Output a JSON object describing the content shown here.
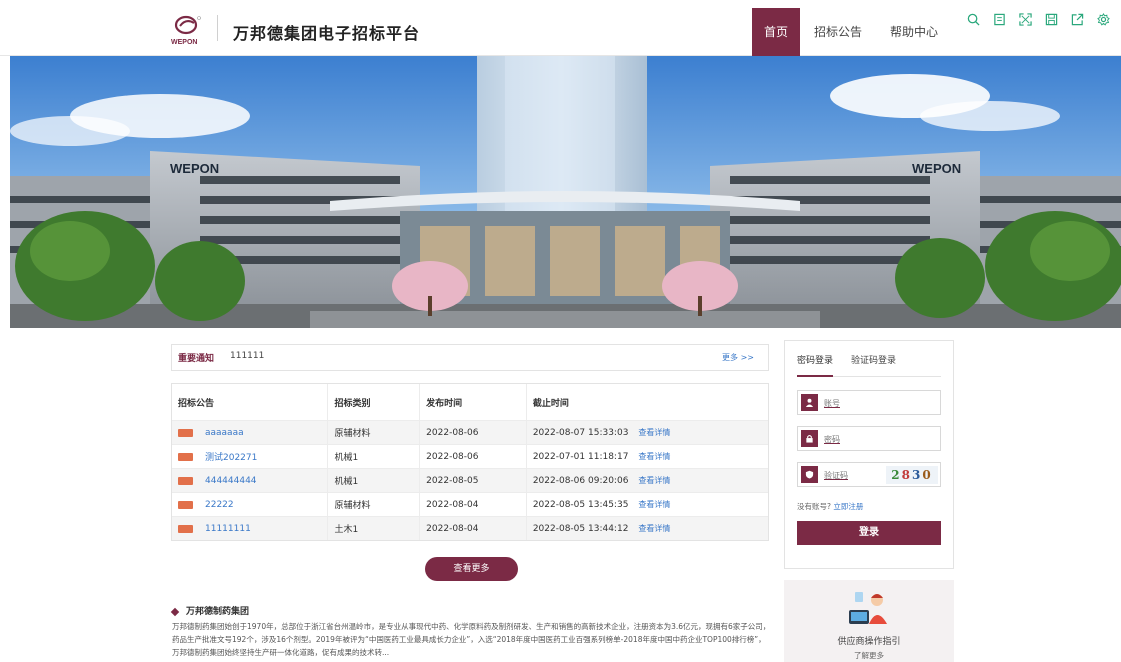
{
  "header": {
    "logo_text": "WEPON",
    "site_title": "万邦德集团电子招标平台",
    "nav": [
      {
        "label": "首页"
      },
      {
        "label": "招标公告"
      },
      {
        "label": "帮助中心"
      }
    ],
    "tools": [
      "search-icon",
      "document-icon",
      "fullscreen-icon",
      "save-icon",
      "export-icon",
      "settings-icon"
    ]
  },
  "banner": {
    "left_sign": "WEPON",
    "right_sign": "WEPON"
  },
  "notice": {
    "label": "重要通知",
    "text": "111111",
    "more": "更多 >>"
  },
  "table": {
    "headers": [
      "招标公告",
      "招标类别",
      "发布时间",
      "截止时间"
    ],
    "rows": [
      {
        "title": "aaaaaaa",
        "category": "原辅材料",
        "publish": "2022-08-06",
        "deadline": "2022-08-07 15:33:03",
        "detail": "查看详情"
      },
      {
        "title": "测试202271",
        "category": "机械1",
        "publish": "2022-08-06",
        "deadline": "2022-07-01 11:18:17",
        "detail": "查看详情"
      },
      {
        "title": "444444444",
        "category": "机械1",
        "publish": "2022-08-05",
        "deadline": "2022-08-06 09:20:06",
        "detail": "查看详情"
      },
      {
        "title": "22222",
        "category": "原辅材料",
        "publish": "2022-08-04",
        "deadline": "2022-08-05 13:45:35",
        "detail": "查看详情"
      },
      {
        "title": "11111111",
        "category": "土木1",
        "publish": "2022-08-04",
        "deadline": "2022-08-05 13:44:12",
        "detail": "查看详情"
      }
    ],
    "more_button": "查看更多"
  },
  "intro": {
    "title": "万邦德制药集团",
    "text": "万邦德制药集团始创于1970年，总部位于浙江省台州温岭市，是专业从事现代中药、化学原料药及制剂研发、生产和销售的高新技术企业，注册资本为3.6亿元，现拥有6家子公司，药品生产批准文号192个，涉及16个剂型。2019年被评为“中国医药工业最具成长力企业”，入选“2018年度中国医药工业百强系列榜单-2018年度中国中药企业TOP100排行榜”，万邦德制药集团始终坚持生产研一体化道路，促有成果的技术转..."
  },
  "login": {
    "tabs": [
      "密码登录",
      "验证码登录"
    ],
    "account_placeholder": "账号",
    "password_placeholder": "密码",
    "captcha_placeholder": "验证码",
    "captcha_digits": [
      "2",
      "8",
      "3",
      "0"
    ],
    "no_account": "没有账号?",
    "register": "立即注册",
    "submit": "登录"
  },
  "guide": {
    "title": "供应商操作指引",
    "sub": "了解更多"
  },
  "colors": {
    "brand": "#7b2a45",
    "link": "#3a78c8",
    "badge": "#e2704a"
  }
}
